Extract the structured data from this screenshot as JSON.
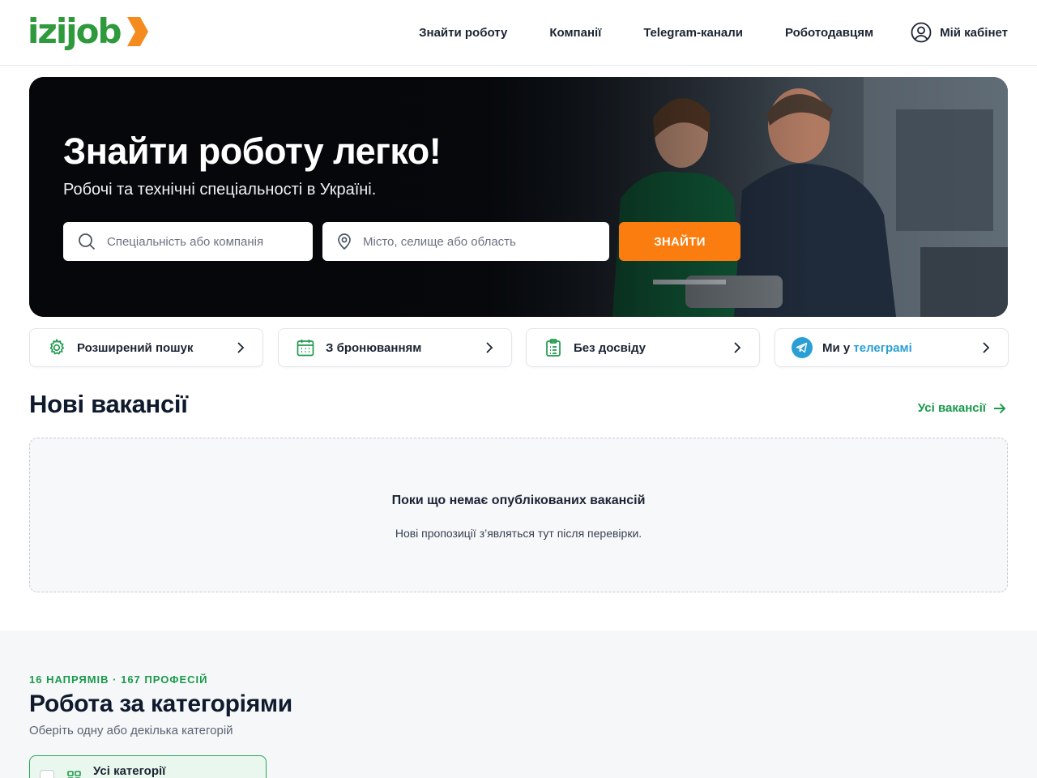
{
  "header": {
    "logo_text": "izijob",
    "nav": [
      {
        "label": "Знайти роботу"
      },
      {
        "label": "Компанії"
      },
      {
        "label": "Telegram-канали"
      },
      {
        "label": "Роботодавцям"
      }
    ],
    "cabinet_label": "Мій кабінет"
  },
  "hero": {
    "title": "Знайти роботу легко!",
    "subtitle": "Робочі та технічні спеціальності в Україні.",
    "search_placeholder": "Спеціальність або компанія",
    "location_placeholder": "Місто, селище або область",
    "find_button": "ЗНАЙТИ"
  },
  "quick_links": [
    {
      "label": "Розширений пошук",
      "icon": "gear-icon"
    },
    {
      "label": "З бронюванням",
      "icon": "calendar-icon"
    },
    {
      "label": "Без досвіду",
      "icon": "clipboard-icon"
    },
    {
      "label_prefix": "Ми у",
      "label_highlight": "телеграмі",
      "icon": "telegram-icon"
    }
  ],
  "vacancies": {
    "title": "Нові вакансії",
    "all_link": "Усі вакансії",
    "empty_title": "Поки що немає опублікованих вакансій",
    "empty_subtitle": "Нові пропозиції з’являться тут після перевірки."
  },
  "categories": {
    "kicker": "16 НАПРЯМІВ · 167 ПРОФЕСІЙ",
    "title": "Робота за категоріями",
    "subtitle": "Оберіть одну або декілька категорій",
    "first_card_label": "Усі категорії"
  },
  "colors": {
    "brand_green": "#2e9a3c",
    "accent_orange": "#fb7d0f",
    "link_green": "#1a9a4a",
    "telegram_blue": "#2a9fd6"
  }
}
